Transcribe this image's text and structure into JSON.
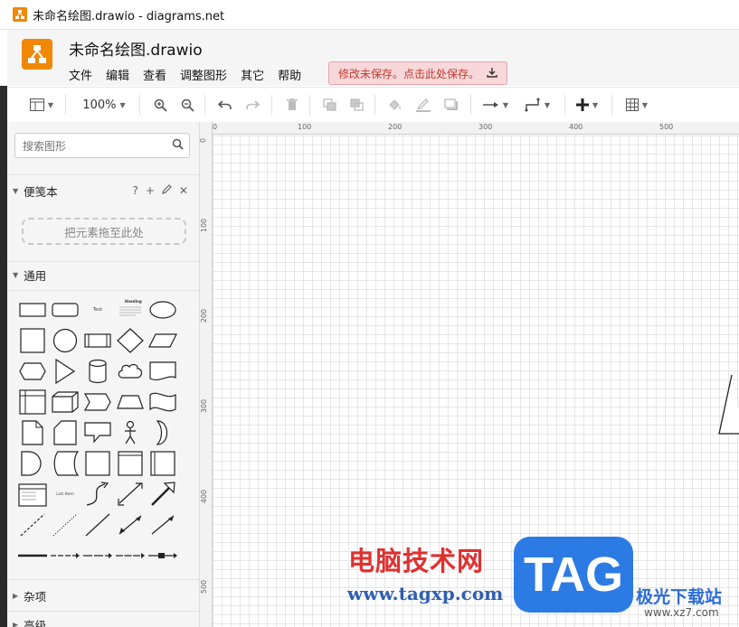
{
  "window": {
    "title": "未命名绘图.drawio - diagrams.net"
  },
  "header": {
    "doc_title": "未命名绘图.drawio",
    "menu": [
      "文件",
      "编辑",
      "查看",
      "调整图形",
      "其它",
      "帮助"
    ],
    "unsaved_notice": "修改未保存。点击此处保存。"
  },
  "toolbar": {
    "zoom": "100%"
  },
  "sidebar": {
    "search_placeholder": "搜索图形",
    "scratchpad": {
      "title": "便笺本",
      "help": "?",
      "dropzone": "把元素拖至此处"
    },
    "general": {
      "title": "通用"
    },
    "misc": {
      "title": "杂项"
    },
    "advanced": {
      "title": "高级"
    },
    "shape_texts": {
      "text": "Text",
      "heading": "Heading",
      "list_item": "List Item"
    }
  },
  "ruler": {
    "top": [
      "0",
      "100",
      "200",
      "300",
      "400",
      "500"
    ],
    "left": [
      "0",
      "100",
      "200",
      "300",
      "400",
      "500"
    ]
  },
  "watermark": {
    "cn": "电脑技术网",
    "url": "www.tagxp.com",
    "tag": "TAG",
    "jg": "极光下载站",
    "xz": "www.xz7.com"
  },
  "colors": {
    "accent": "#f08705",
    "unsaved_bg": "#f8d7da",
    "unsaved_text": "#c0392b"
  }
}
